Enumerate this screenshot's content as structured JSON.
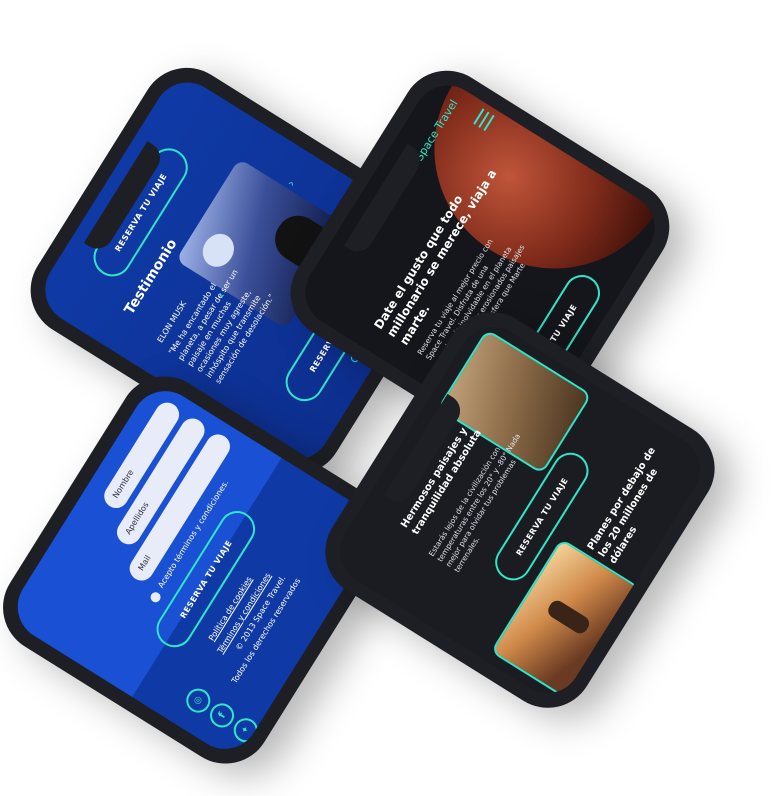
{
  "phone_testimonial": {
    "reserve_top": "RESERVA TU VIAJE",
    "title": "Testimonio",
    "author": "ELON MUSK",
    "quote": "\"Me ha encantado el planeta, a pesar de ser un paisaje en muchas ocasiones muy agreste, inhóspito que transmite sensación de desolación.\"",
    "reserve_bottom": "RESERVA TU VIAJE"
  },
  "phone_hero": {
    "brand": "Space Travel",
    "headline": "Date el gusto que todo millonario se merece, viaja a marte.",
    "body": "Reserva tu viaje al mejor precio con Space Travel. Disfruta de una experiencia inolvidable en el planeta rojo, descubre los erosionados paisajes y la inhóspita atmósfera que Marte tiene para ofrecer.",
    "reserve": "RESERVA TU VIAJE"
  },
  "phone_form": {
    "name_placeholder": "Nombre",
    "surname_placeholder": "Apellidos",
    "mail_placeholder": "Mail",
    "terms": "Acepto términos y condiciones.",
    "reserve": "RESERVA TU VIAJE",
    "cookies": "Política de cookies",
    "terms_link": "Términos y condiciones",
    "copyright": "© 2013 Space Travel.",
    "rights": "Todos los derechos reservados"
  },
  "phone_landscape": {
    "heading": "Hermosos paisajes y tranquilidad absoluta",
    "body": "Estarás lejos de la civilización con temperaturas entre los 20° y -80° Nada mejor para olvidar tus problemas terrenales.",
    "reserve": "RESERVA TU VIAJE",
    "plans": "Planes por debajo de los 20 millones de dólares"
  },
  "colors": {
    "accent": "#2ee6c8",
    "blue": "#0f3aa6",
    "dark": "#1a1c22"
  }
}
